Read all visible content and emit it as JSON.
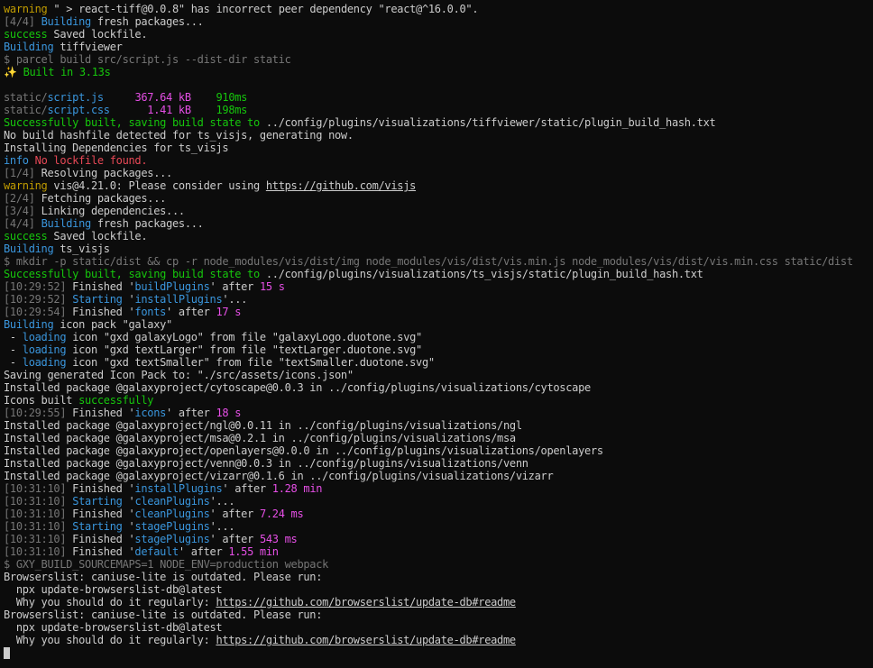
{
  "colors": {
    "default": "#cccccc",
    "yellow": "#c19c00",
    "green": "#16c60c",
    "cyan": "#3a96dd",
    "blue": "#3b78ff",
    "red": "#e74856",
    "magenta": "#e74fe7",
    "gray": "#767676"
  },
  "lines": [
    [
      {
        "t": "warning",
        "c": "yellow"
      },
      {
        "t": " \" > react-tiff@0.0.8\" has incorrect peer dependency \"react@^16.0.0\"."
      }
    ],
    [
      {
        "t": "[4/4] ",
        "c": "gray"
      },
      {
        "t": "Building",
        "c": "cyan"
      },
      {
        "t": " fresh packages..."
      }
    ],
    [
      {
        "t": "success",
        "c": "green"
      },
      {
        "t": " Saved lockfile."
      }
    ],
    [
      {
        "t": "Building",
        "c": "cyan"
      },
      {
        "t": " tiffviewer"
      }
    ],
    [
      {
        "t": "$ parcel build src/script.js --dist-dir static",
        "c": "gray"
      }
    ],
    [
      {
        "t": "✨ Built in 3.13s",
        "c": "green"
      }
    ],
    [
      {
        "t": ""
      }
    ],
    [
      {
        "t": "static/",
        "c": "gray"
      },
      {
        "t": "script.js",
        "c": "cyan"
      },
      {
        "t": "     "
      },
      {
        "t": "367.64 kB",
        "c": "magenta"
      },
      {
        "t": "    "
      },
      {
        "t": "910ms",
        "c": "green"
      }
    ],
    [
      {
        "t": "static/",
        "c": "gray"
      },
      {
        "t": "script.css",
        "c": "cyan"
      },
      {
        "t": "      "
      },
      {
        "t": "1.41 kB",
        "c": "magenta"
      },
      {
        "t": "    "
      },
      {
        "t": "198ms",
        "c": "green"
      }
    ],
    [
      {
        "t": "Successfully built, saving build state to",
        "c": "green"
      },
      {
        "t": " ../config/plugins/visualizations/tiffviewer/static/plugin_build_hash.txt"
      }
    ],
    [
      {
        "t": "No build hashfile detected for ts_visjs, generating now."
      }
    ],
    [
      {
        "t": "Installing Dependencies for ts_visjs"
      }
    ],
    [
      {
        "t": "info",
        "c": "cyan"
      },
      {
        "t": " "
      },
      {
        "t": "No lockfile found.",
        "c": "red"
      }
    ],
    [
      {
        "t": "[1/4] ",
        "c": "gray"
      },
      {
        "t": "Resolving packages..."
      }
    ],
    [
      {
        "t": "warning",
        "c": "yellow"
      },
      {
        "t": " vis@4.21.0: Please consider using "
      },
      {
        "t": "https://github.com/visjs",
        "link": true
      }
    ],
    [
      {
        "t": "[2/4] ",
        "c": "gray"
      },
      {
        "t": "Fetching packages..."
      }
    ],
    [
      {
        "t": "[3/4] ",
        "c": "gray"
      },
      {
        "t": "Linking dependencies..."
      }
    ],
    [
      {
        "t": "[4/4] ",
        "c": "gray"
      },
      {
        "t": "Building",
        "c": "cyan"
      },
      {
        "t": " fresh packages..."
      }
    ],
    [
      {
        "t": "success",
        "c": "green"
      },
      {
        "t": " Saved lockfile."
      }
    ],
    [
      {
        "t": "Building",
        "c": "cyan"
      },
      {
        "t": " ts_visjs"
      }
    ],
    [
      {
        "t": "$ mkdir -p static/dist && cp -r node_modules/vis/dist/img node_modules/vis/dist/vis.min.js node_modules/vis/dist/vis.min.css static/dist",
        "c": "gray"
      }
    ],
    [
      {
        "t": "Successfully built, saving build state to",
        "c": "green"
      },
      {
        "t": " ../config/plugins/visualizations/ts_visjs/static/plugin_build_hash.txt"
      }
    ],
    [
      {
        "t": "[10:29:52]",
        "c": "gray"
      },
      {
        "t": " Finished '"
      },
      {
        "t": "buildPlugins",
        "c": "cyan"
      },
      {
        "t": "' after "
      },
      {
        "t": "15 s",
        "c": "magenta"
      }
    ],
    [
      {
        "t": "[10:29:52]",
        "c": "gray"
      },
      {
        "t": " "
      },
      {
        "t": "Starting",
        "c": "cyan"
      },
      {
        "t": " '"
      },
      {
        "t": "installPlugins",
        "c": "cyan"
      },
      {
        "t": "'..."
      }
    ],
    [
      {
        "t": "[10:29:54]",
        "c": "gray"
      },
      {
        "t": " Finished '"
      },
      {
        "t": "fonts",
        "c": "cyan"
      },
      {
        "t": "' after "
      },
      {
        "t": "17 s",
        "c": "magenta"
      }
    ],
    [
      {
        "t": "Building",
        "c": "cyan"
      },
      {
        "t": " icon pack \"galaxy\""
      }
    ],
    [
      {
        "t": " - "
      },
      {
        "t": "loading",
        "c": "cyan"
      },
      {
        "t": " icon \"gxd galaxyLogo\" from file \"galaxyLogo.duotone.svg\""
      }
    ],
    [
      {
        "t": " - "
      },
      {
        "t": "loading",
        "c": "cyan"
      },
      {
        "t": " icon \"gxd textLarger\" from file \"textLarger.duotone.svg\""
      }
    ],
    [
      {
        "t": " - "
      },
      {
        "t": "loading",
        "c": "cyan"
      },
      {
        "t": " icon \"gxd textSmaller\" from file \"textSmaller.duotone.svg\""
      }
    ],
    [
      {
        "t": "Saving generated Icon Pack to: \"./src/assets/icons.json\""
      }
    ],
    [
      {
        "t": "Installed package @galaxyproject/cytoscape@0.0.3 in ../config/plugins/visualizations/cytoscape"
      }
    ],
    [
      {
        "t": "Icons built "
      },
      {
        "t": "successfully",
        "c": "green"
      }
    ],
    [
      {
        "t": "[10:29:55]",
        "c": "gray"
      },
      {
        "t": " Finished '"
      },
      {
        "t": "icons",
        "c": "cyan"
      },
      {
        "t": "' after "
      },
      {
        "t": "18 s",
        "c": "magenta"
      }
    ],
    [
      {
        "t": "Installed package @galaxyproject/ngl@0.0.11 in ../config/plugins/visualizations/ngl"
      }
    ],
    [
      {
        "t": "Installed package @galaxyproject/msa@0.2.1 in ../config/plugins/visualizations/msa"
      }
    ],
    [
      {
        "t": "Installed package @galaxyproject/openlayers@0.0.0 in ../config/plugins/visualizations/openlayers"
      }
    ],
    [
      {
        "t": "Installed package @galaxyproject/venn@0.0.3 in ../config/plugins/visualizations/venn"
      }
    ],
    [
      {
        "t": "Installed package @galaxyproject/vizarr@0.1.6 in ../config/plugins/visualizations/vizarr"
      }
    ],
    [
      {
        "t": "[10:31:10]",
        "c": "gray"
      },
      {
        "t": " Finished '"
      },
      {
        "t": "installPlugins",
        "c": "cyan"
      },
      {
        "t": "' after "
      },
      {
        "t": "1.28 min",
        "c": "magenta"
      }
    ],
    [
      {
        "t": "[10:31:10]",
        "c": "gray"
      },
      {
        "t": " "
      },
      {
        "t": "Starting",
        "c": "cyan"
      },
      {
        "t": " '"
      },
      {
        "t": "cleanPlugins",
        "c": "cyan"
      },
      {
        "t": "'..."
      }
    ],
    [
      {
        "t": "[10:31:10]",
        "c": "gray"
      },
      {
        "t": " Finished '"
      },
      {
        "t": "cleanPlugins",
        "c": "cyan"
      },
      {
        "t": "' after "
      },
      {
        "t": "7.24 ms",
        "c": "magenta"
      }
    ],
    [
      {
        "t": "[10:31:10]",
        "c": "gray"
      },
      {
        "t": " "
      },
      {
        "t": "Starting",
        "c": "cyan"
      },
      {
        "t": " '"
      },
      {
        "t": "stagePlugins",
        "c": "cyan"
      },
      {
        "t": "'..."
      }
    ],
    [
      {
        "t": "[10:31:10]",
        "c": "gray"
      },
      {
        "t": " Finished '"
      },
      {
        "t": "stagePlugins",
        "c": "cyan"
      },
      {
        "t": "' after "
      },
      {
        "t": "543 ms",
        "c": "magenta"
      }
    ],
    [
      {
        "t": "[10:31:10]",
        "c": "gray"
      },
      {
        "t": " Finished '"
      },
      {
        "t": "default",
        "c": "cyan"
      },
      {
        "t": "' after "
      },
      {
        "t": "1.55 min",
        "c": "magenta"
      }
    ],
    [
      {
        "t": "$ GXY_BUILD_SOURCEMAPS=1 NODE_ENV=production webpack",
        "c": "gray"
      }
    ],
    [
      {
        "t": "Browserslist: caniuse-lite is outdated. Please run:"
      }
    ],
    [
      {
        "t": "  npx update-browserslist-db@latest"
      }
    ],
    [
      {
        "t": "  Why you should do it regularly: "
      },
      {
        "t": "https://github.com/browserslist/update-db#readme",
        "link": true
      }
    ],
    [
      {
        "t": "Browserslist: caniuse-lite is outdated. Please run:"
      }
    ],
    [
      {
        "t": "  npx update-browserslist-db@latest"
      }
    ],
    [
      {
        "t": "  Why you should do it regularly: "
      },
      {
        "t": "https://github.com/browserslist/update-db#readme",
        "link": true
      }
    ]
  ]
}
